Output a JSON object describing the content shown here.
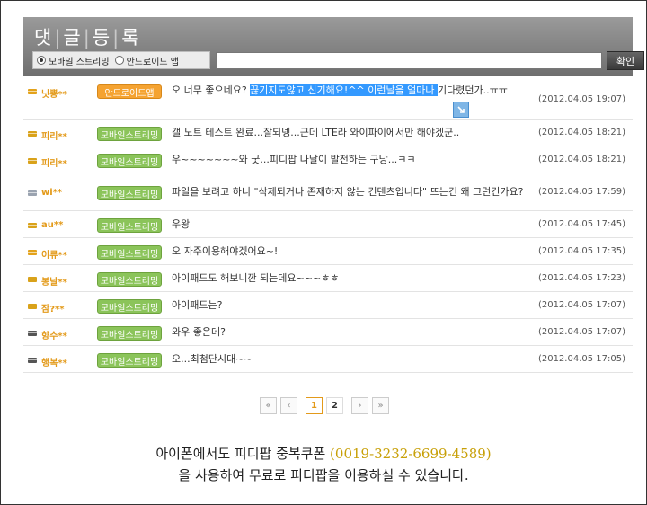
{
  "header": {
    "title_chars": [
      "댓",
      "글",
      "등",
      "록"
    ],
    "radios": [
      {
        "label": "모바일 스트리밍",
        "checked": true
      },
      {
        "label": "안드로이드 앱",
        "checked": false
      }
    ],
    "input_value": "",
    "confirm_label": "확인"
  },
  "comments": [
    {
      "nick": "닛뿅**",
      "badge": "안드로이드앱",
      "badge_type": "android",
      "text_before": "오 너무 좋으네요? ",
      "text_highlight": "끊기지도않고 신기해요!^^ 이런날을 얼마나 ",
      "text_after": "기다렸던가..ㅠㅠ",
      "date": "(2012.04.05 19:07)",
      "rank_color": "#e3a21a"
    },
    {
      "nick": "피리**",
      "badge": "모바일스트리밍",
      "badge_type": "mobile",
      "text_before": "갤 노트 테스트 완료...잘되넹...근데 LTE라 와이파이에서만 해야겠군..",
      "text_highlight": "",
      "text_after": "",
      "date": "(2012.04.05 18:21)",
      "rank_color": "#d9a21a"
    },
    {
      "nick": "피리**",
      "badge": "모바일스트리밍",
      "badge_type": "mobile",
      "text_before": "우~~~~~~~와 굿...피디팝 나날이 발전하는 구낭...ㅋㅋ",
      "text_highlight": "",
      "text_after": "",
      "date": "(2012.04.05 18:21)",
      "rank_color": "#d9a21a"
    },
    {
      "nick": "wi**",
      "badge": "모바일스트리밍",
      "badge_type": "mobile",
      "text_before": "파일을 보려고 하니 \"삭제되거나 존재하지 않는 컨텐츠입니다\" 뜨는건 왜 그런건가요?",
      "text_highlight": "",
      "text_after": "",
      "date": "(2012.04.05 17:59)",
      "rank_color": "#9aa3b0"
    },
    {
      "nick": "au**",
      "badge": "모바일스트리밍",
      "badge_type": "mobile",
      "text_before": "우왕",
      "text_highlight": "",
      "text_after": "",
      "date": "(2012.04.05 17:45)",
      "rank_color": "#d9a21a"
    },
    {
      "nick": "이류**",
      "badge": "모바일스트리밍",
      "badge_type": "mobile",
      "text_before": "오 자주이용해야겠어요~!",
      "text_highlight": "",
      "text_after": "",
      "date": "(2012.04.05 17:35)",
      "rank_color": "#e3a21a"
    },
    {
      "nick": "봉날**",
      "badge": "모바일스트리밍",
      "badge_type": "mobile",
      "text_before": "아이패드도 해보니깐 되는데요~~~ㅎㅎ",
      "text_highlight": "",
      "text_after": "",
      "date": "(2012.04.05 17:23)",
      "rank_color": "#d9a21a"
    },
    {
      "nick": "잠?**",
      "badge": "모바일스트리밍",
      "badge_type": "mobile",
      "text_before": "아이패드는?",
      "text_highlight": "",
      "text_after": "",
      "date": "(2012.04.05 17:07)",
      "rank_color": "#d9a21a"
    },
    {
      "nick": "향수**",
      "badge": "모바일스트리밍",
      "badge_type": "mobile",
      "text_before": "와우 좋은데?",
      "text_highlight": "",
      "text_after": "",
      "date": "(2012.04.05 17:07)",
      "rank_color": "#555555"
    },
    {
      "nick": "행복**",
      "badge": "모바일스트리밍",
      "badge_type": "mobile",
      "text_before": "오...최첨단시대~~",
      "text_highlight": "",
      "text_after": "",
      "date": "(2012.04.05 17:05)",
      "rank_color": "#555555"
    }
  ],
  "pager": {
    "first": "«",
    "prev": "‹",
    "pages": [
      "1",
      "2"
    ],
    "current": "1",
    "next": "›",
    "last": "»"
  },
  "footer": {
    "line1_before": "아이폰에서도 피디팝 중복쿠폰 ",
    "line1_coupon": "(0019-3232-6699-4589)",
    "line2": "을 사용하여 무료로 피디팝을 이용하실 수 있습니다."
  }
}
